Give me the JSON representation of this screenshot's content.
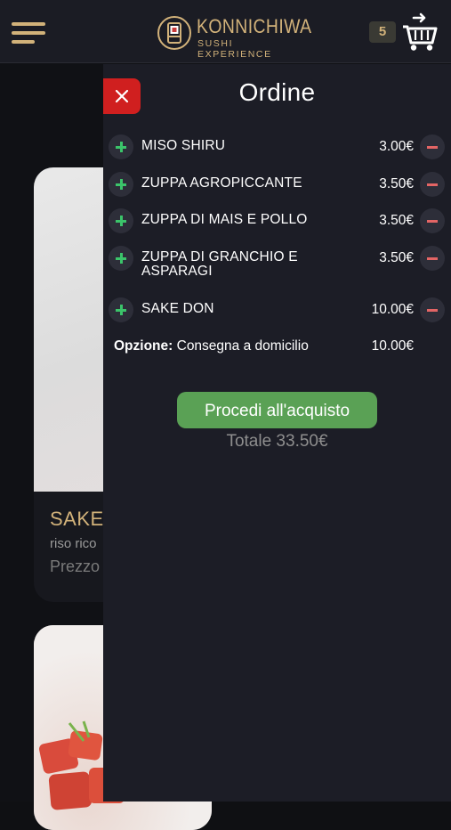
{
  "header": {
    "brand_title": "KONNICHIWA",
    "brand_subtitle": "SUSHI EXPERIENCE",
    "cart_count": "5"
  },
  "background_menu": {
    "card1": {
      "title": "SAKE",
      "description": "riso rico",
      "price_label": "Prezzo"
    }
  },
  "cart": {
    "title": "Ordine",
    "items": [
      {
        "name": "MISO SHIRU",
        "price": "3.00€"
      },
      {
        "name": "ZUPPA AGROPICCANTE",
        "price": "3.50€"
      },
      {
        "name": "ZUPPA DI MAIS E POLLO",
        "price": "3.50€"
      },
      {
        "name": "ZUPPA DI GRANCHIO E ASPARAGI",
        "price": "3.50€"
      },
      {
        "name": "SAKE DON",
        "price": "10.00€"
      }
    ],
    "option_label": "Opzione:",
    "option_value": " Consegna a domicilio",
    "option_price": "10.00€",
    "checkout_label": "Procedi all'acquisto",
    "total": "Totale 33.50€"
  },
  "colors": {
    "accent_gold": "#d2b27a",
    "checkout_green": "#5aa155",
    "close_red": "#d01f1f",
    "plus_green": "#3bc46a",
    "minus_red": "#e36565"
  },
  "icons": [
    "hamburger-menu-icon",
    "logo-roll-icon",
    "cart-icon",
    "close-icon",
    "plus-icon",
    "minus-icon"
  ]
}
